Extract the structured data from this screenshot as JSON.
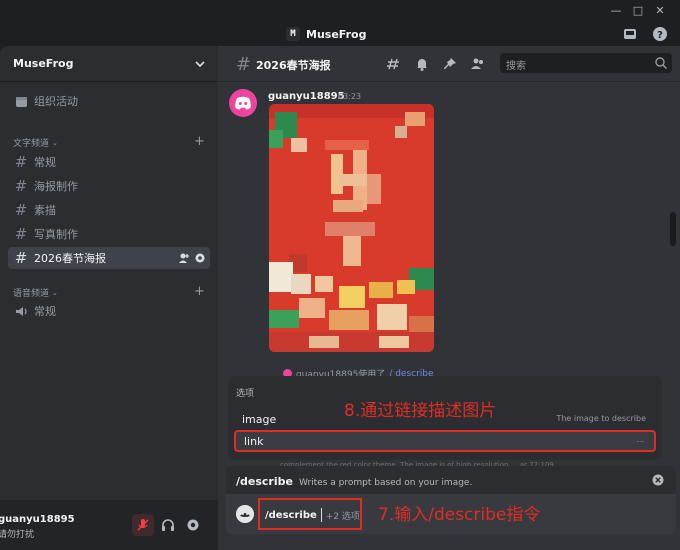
{
  "app": {
    "title": "MuseFrog",
    "logo_letter": "M"
  },
  "server": {
    "name": "MuseFrog"
  },
  "sidebar": {
    "events_label": "组织活动",
    "text_category": "文字频道",
    "voice_category": "语音频道",
    "text_channels": [
      {
        "name": "常规"
      },
      {
        "name": "海报制作"
      },
      {
        "name": "素描"
      },
      {
        "name": "写真制作"
      },
      {
        "name": "2026春节海报"
      }
    ],
    "voice_channels": [
      {
        "name": "常规"
      }
    ]
  },
  "user": {
    "name": "guanyu18895",
    "status": "请勿打扰"
  },
  "channel": {
    "name": "2026春节海报",
    "search_placeholder": "搜索"
  },
  "message": {
    "author": "guanyu18895",
    "time": "03:23",
    "used_text": "guanyu18895使用了",
    "used_command": "/ describe"
  },
  "options": {
    "title": "选项",
    "items": [
      {
        "label": "image",
        "desc": "The image to describe"
      },
      {
        "label": "link",
        "desc": "..."
      }
    ]
  },
  "hidden_text": "complement the red color theme. The image is of high resolution … ar 72:109",
  "command": {
    "name": "/describe",
    "desc": "Writes a prompt based on your image.",
    "input_cmd": "/describe",
    "extra": "+2 选项"
  },
  "annotations": {
    "step8": "8.通过链接描述图片",
    "step7": "7.输入/describe指令"
  },
  "colors": {
    "accent_red": "#e02d24",
    "avatar_pink": "#eb459e",
    "poster_red": "#d83a2c"
  }
}
